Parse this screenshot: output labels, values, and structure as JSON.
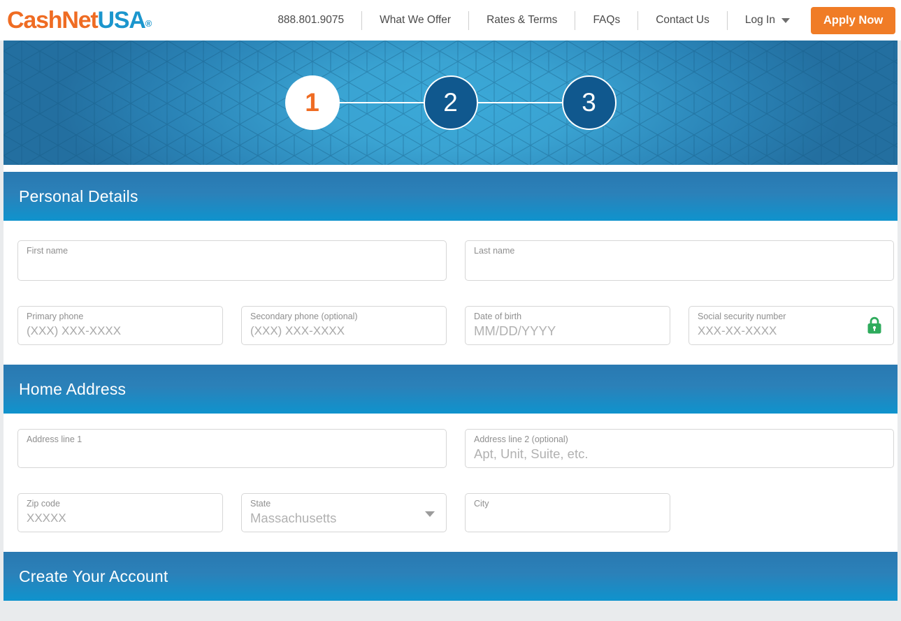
{
  "brand": {
    "logo_primary": "CashNet",
    "logo_secondary": "USA",
    "logo_mark": "®",
    "color_orange": "#ef6c23",
    "color_blue": "#1b96cd"
  },
  "nav": {
    "phone": "888.801.9075",
    "links": [
      "What We Offer",
      "Rates & Terms",
      "FAQs",
      "Contact Us"
    ],
    "login_label": "Log In",
    "apply_label": "Apply Now"
  },
  "stepper": {
    "steps": [
      {
        "number": "1",
        "state": "active"
      },
      {
        "number": "2",
        "state": "pending"
      },
      {
        "number": "3",
        "state": "pending"
      }
    ]
  },
  "sections": [
    {
      "title": "Personal Details"
    },
    {
      "title": "Home Address"
    },
    {
      "title": "Create Your Account"
    }
  ],
  "personal_details": {
    "first_name": {
      "label": "First name",
      "placeholder": ""
    },
    "last_name": {
      "label": "Last name",
      "placeholder": ""
    },
    "primary_phone": {
      "label": "Primary phone",
      "placeholder": "(XXX) XXX-XXXX"
    },
    "secondary_phone": {
      "label": "Secondary phone (optional)",
      "placeholder": "(XXX) XXX-XXXX"
    },
    "date_of_birth": {
      "label": "Date of birth",
      "placeholder": "MM/DD/YYYY"
    },
    "ssn": {
      "label": "Social security number",
      "placeholder": "XXX-XX-XXXX",
      "icon": "lock-icon",
      "icon_color": "#2eab5c"
    }
  },
  "home_address": {
    "address_line_1": {
      "label": "Address line 1",
      "placeholder": ""
    },
    "address_line_2": {
      "label": "Address line 2 (optional)",
      "placeholder": "Apt, Unit, Suite, etc."
    },
    "zip_code": {
      "label": "Zip code",
      "placeholder": "XXXXX"
    },
    "state": {
      "label": "State",
      "value": "Massachusetts"
    },
    "city": {
      "label": "City",
      "placeholder": ""
    }
  }
}
